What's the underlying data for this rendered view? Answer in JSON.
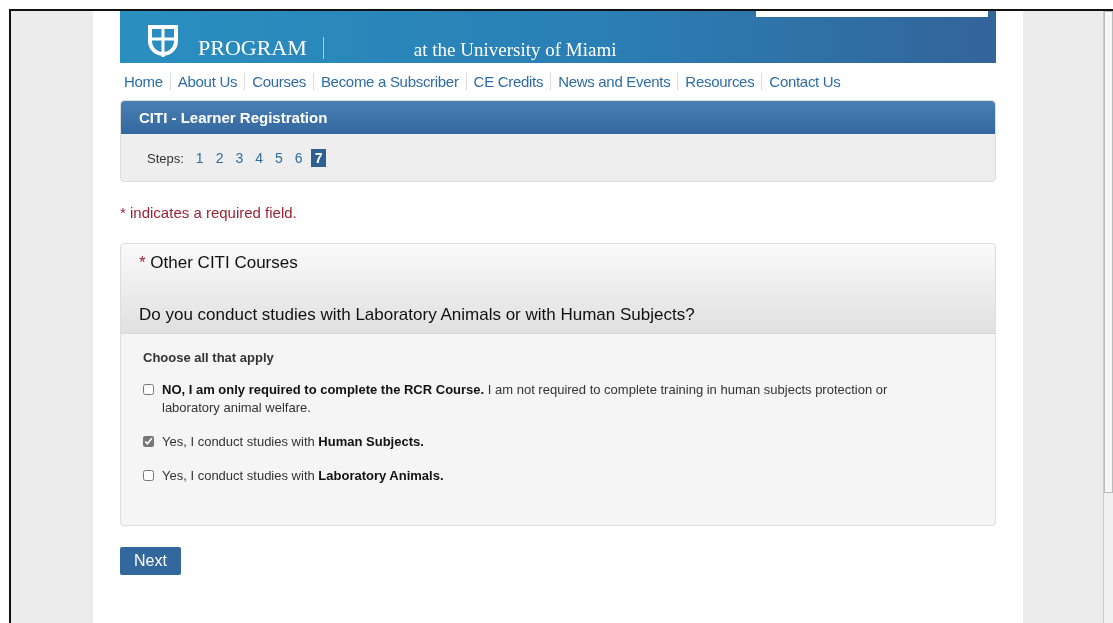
{
  "banner": {
    "logo_text": "PROGRAM",
    "subtitle": "at the University of Miami"
  },
  "nav": [
    "Home",
    "About Us",
    "Courses",
    "Become a Subscriber",
    "CE Credits",
    "News and Events",
    "Resources",
    "Contact Us"
  ],
  "registration_panel": {
    "title": "CITI - Learner Registration",
    "steps_label": "Steps:",
    "steps": [
      {
        "label": "1",
        "selected": false
      },
      {
        "label": "2",
        "selected": false
      },
      {
        "label": "3",
        "selected": false
      },
      {
        "label": "4",
        "selected": false
      },
      {
        "label": "5",
        "selected": false
      },
      {
        "label": "6",
        "selected": false
      },
      {
        "label": "7",
        "selected": true
      }
    ]
  },
  "required_note": {
    "asterisk": "*",
    "text": "indicates a required field."
  },
  "question_panel": {
    "asterisk": "*",
    "section_title": "Other CITI Courses",
    "question": "Do you conduct studies with Laboratory Animals or with Human Subjects?",
    "instruction": "Choose all that apply",
    "options": [
      {
        "label": "**NO, I am only required to complete the RCR Course.** I am not required to complete training in human subjects protection or laboratory animal welfare.",
        "checked": false
      },
      {
        "label": "Yes, I conduct studies with **Human Subjects.**",
        "checked": true
      },
      {
        "label": "Yes, I conduct studies with **Laboratory Animals.**",
        "checked": false
      }
    ]
  },
  "next_button": "Next"
}
